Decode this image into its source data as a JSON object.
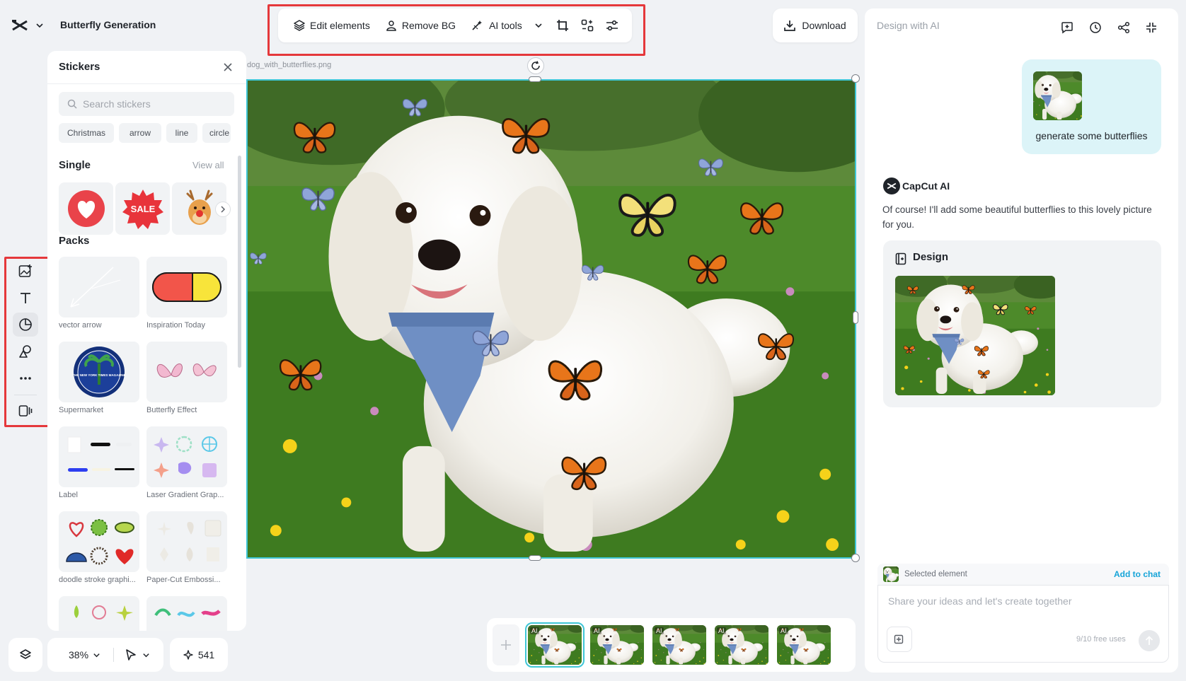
{
  "header": {
    "project_title": "Butterfly Generation",
    "download_label": "Download"
  },
  "toolbar": {
    "edit_elements": "Edit elements",
    "remove_bg": "Remove BG",
    "ai_tools": "AI tools"
  },
  "stickers": {
    "title": "Stickers",
    "search_placeholder": "Search stickers",
    "chips": [
      "Christmas",
      "arrow",
      "line",
      "circle"
    ],
    "single_title": "Single",
    "view_all": "View all",
    "single_sale_text": "SALE",
    "packs_title": "Packs",
    "packs": [
      {
        "label": "vector arrow"
      },
      {
        "label": "Inspiration Today"
      },
      {
        "label": "Supermarket"
      },
      {
        "label": "Butterfly Effect"
      },
      {
        "label": "Label"
      },
      {
        "label": "Laser Gradient Grap..."
      },
      {
        "label": "doodle stroke graphi..."
      },
      {
        "label": "Paper-Cut Embossi..."
      }
    ],
    "supermarket_badge_text": "THE NEW YORK TIMES MAGAZINE"
  },
  "bottom_controls": {
    "zoom": "38%",
    "credits": "541"
  },
  "canvas": {
    "file_name": "dog_with_butterflies.png"
  },
  "filmstrip": {
    "thumb_badge": "AI",
    "thumb_count": 5
  },
  "ai_panel": {
    "title": "Design with AI",
    "user_message": "generate some butterflies",
    "ai_name": "CapCut AI",
    "ai_reply": "Of course! I'll add some beautiful butterflies to this lovely picture for you.",
    "design_card_title": "Design",
    "selected_element_label": "Selected element",
    "add_to_chat": "Add to chat",
    "chat_placeholder": "Share your ideas and let's create together",
    "free_uses": "9/10 free uses"
  },
  "colors": {
    "accent_cyan": "#3fc6d6",
    "highlight_red": "#e5383b",
    "link_blue": "#16a4d8"
  }
}
